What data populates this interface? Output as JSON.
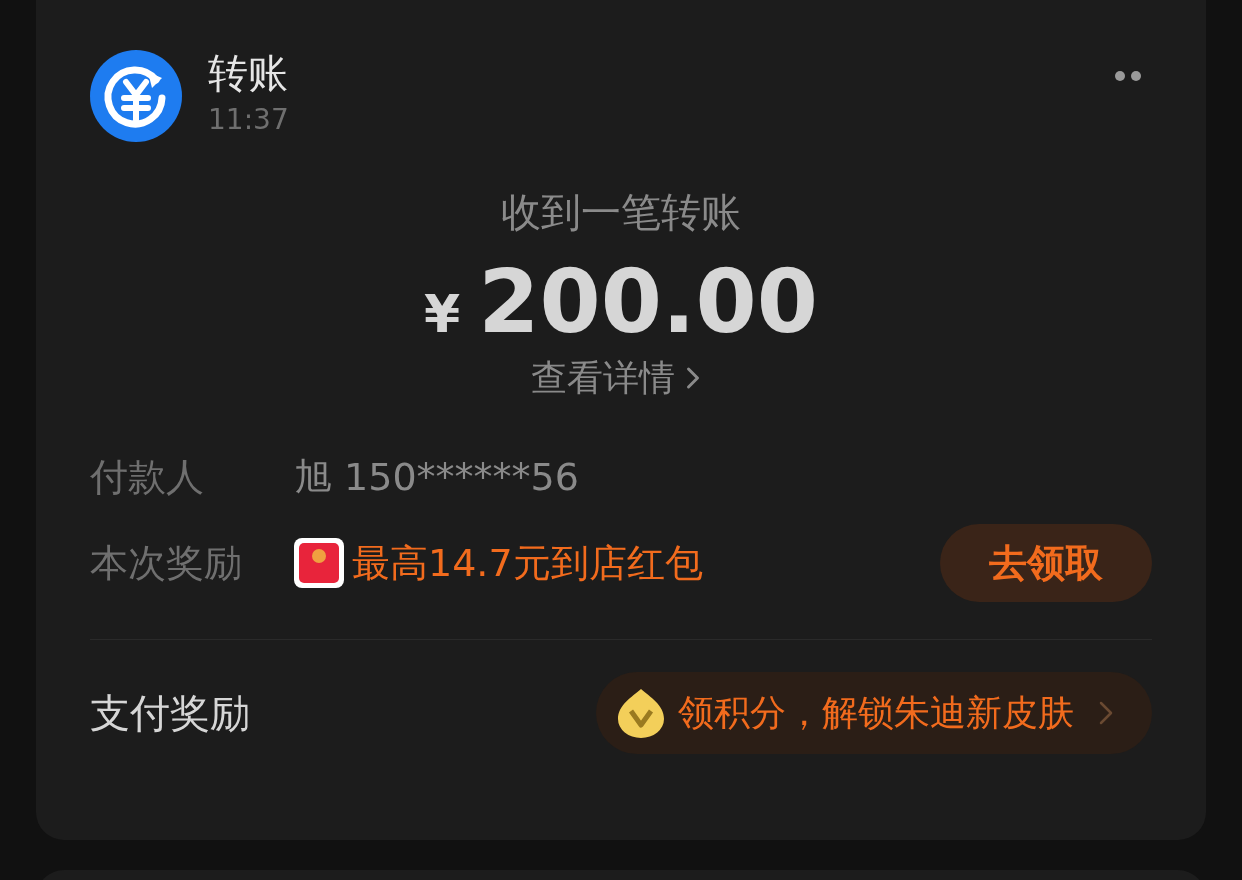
{
  "message": {
    "title": "转账",
    "time": "11:37"
  },
  "headline": "收到一笔转账",
  "amount": {
    "currency": "¥",
    "value": "200.00"
  },
  "details_link": "查看详情",
  "rows": [
    {
      "kind": "text",
      "label": "付款人",
      "value": "旭 150******56"
    },
    {
      "kind": "reward",
      "label": "本次奖励",
      "value": "最高14.7元到店红包",
      "action": "去领取"
    }
  ],
  "footer": {
    "label": "支付奖励",
    "promo": "领积分，解锁朱迪新皮肤"
  }
}
